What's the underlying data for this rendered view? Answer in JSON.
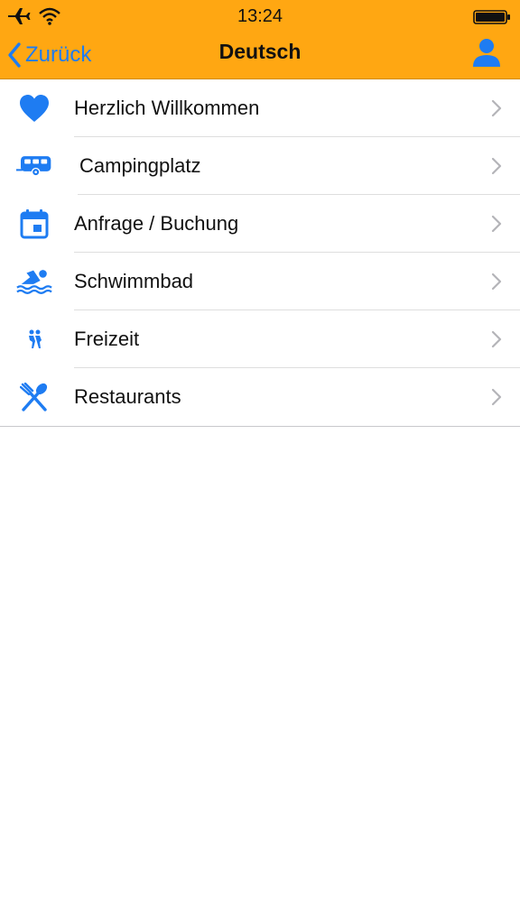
{
  "status_bar": {
    "time": "13:24"
  },
  "navbar": {
    "back_label": "Zurück",
    "title": "Deutsch"
  },
  "colors": {
    "accent": "#1E7CF2",
    "header": "#FFA712"
  },
  "menu": {
    "items": [
      {
        "label": "Herzlich Willkommen",
        "icon": "heart-icon"
      },
      {
        "label": "Campingplatz",
        "icon": "caravan-icon"
      },
      {
        "label": "Anfrage / Buchung",
        "icon": "calendar-icon"
      },
      {
        "label": "Schwimmbad",
        "icon": "swimmer-icon"
      },
      {
        "label": "Freizeit",
        "icon": "hikers-icon"
      },
      {
        "label": "Restaurants",
        "icon": "utensils-icon"
      }
    ]
  }
}
